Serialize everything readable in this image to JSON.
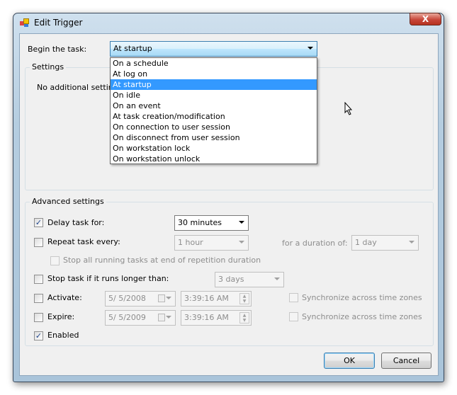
{
  "window": {
    "title": "Edit Trigger",
    "close_label": "X"
  },
  "begin": {
    "label": "Begin the task:",
    "value": "At startup",
    "options": [
      "On a schedule",
      "At log on",
      "At startup",
      "On idle",
      "On an event",
      "At task creation/modification",
      "On connection to user session",
      "On disconnect from user session",
      "On workstation lock",
      "On workstation unlock"
    ],
    "selected_index": 2
  },
  "settings": {
    "label": "Settings",
    "text": "No additional settin"
  },
  "advanced": {
    "label": "Advanced settings",
    "delay": {
      "label": "Delay task for:",
      "checked": true,
      "value": "30 minutes"
    },
    "repeat": {
      "label": "Repeat task every:",
      "checked": false,
      "value": "1 hour",
      "duration_label": "for a duration of:",
      "duration_value": "1 day"
    },
    "stop_all": {
      "label": "Stop all running tasks at end of repetition duration",
      "checked": false
    },
    "stop_task": {
      "label": "Stop task if it runs longer than:",
      "checked": false,
      "value": "3 days"
    },
    "activate": {
      "label": "Activate:",
      "checked": false,
      "date": "5/ 5/2008",
      "time": "3:39:16 AM",
      "sync_label": "Synchronize across time zones"
    },
    "expire": {
      "label": "Expire:",
      "checked": false,
      "date": "5/ 5/2009",
      "time": "3:39:16 AM",
      "sync_label": "Synchronize across time zones"
    },
    "enabled": {
      "label": "Enabled",
      "checked": true
    }
  },
  "buttons": {
    "ok": "OK",
    "cancel": "Cancel"
  }
}
